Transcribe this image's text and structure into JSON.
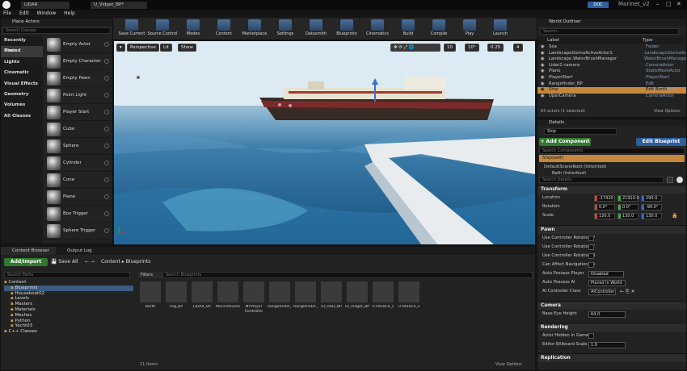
{
  "titlebar": {
    "tabs": [
      "LIDAR",
      "U_Vidget_BP*"
    ],
    "badge": "DOC",
    "project": "Marinet_v2"
  },
  "menubar": [
    "File",
    "Edit",
    "Window",
    "Help"
  ],
  "toolbar": [
    "Save Current",
    "Source Control",
    "Modes",
    "Content",
    "Marketplace",
    "Settings",
    "Datasmith",
    "Blueprints",
    "Cinematics",
    "Build",
    "Compile",
    "Play",
    "Launch"
  ],
  "place_actors": {
    "title": "Place Actors",
    "search_placeholder": "Search Classes",
    "categories": [
      "Recently Placed",
      "Basic",
      "Lights",
      "Cinematic",
      "Visual Effects",
      "Geometry",
      "Volumes",
      "All Classes"
    ],
    "selected_category": "Basic",
    "actors": [
      "Empty Actor",
      "Empty Character",
      "Empty Pawn",
      "Point Light",
      "Player Start",
      "Cube",
      "Sphere",
      "Cylinder",
      "Cone",
      "Plane",
      "Box Trigger",
      "Sphere Trigger"
    ]
  },
  "viewport": {
    "buttons": [
      "Perspective",
      "Lit",
      "Show"
    ],
    "grid": "10",
    "angle": "10°",
    "scale": "0.25",
    "cam": "4"
  },
  "outliner": {
    "title": "World Outliner",
    "search_placeholder": "Search...",
    "col_label": "Label",
    "col_type": "Type",
    "rows": [
      {
        "label": "Sea",
        "type": "Folder"
      },
      {
        "label": "LandscapeGizmoActiveActor1",
        "type": "LandscapeGizmoAc"
      },
      {
        "label": "Landscape.WaterBrushManager",
        "type": "WaterBrushManage"
      },
      {
        "label": "Lidar2 camera",
        "type": "CameraActor"
      },
      {
        "label": "Plane",
        "type": "StaticMeshActor"
      },
      {
        "label": "PlayerStart",
        "type": "PlayerStart"
      },
      {
        "label": "Rangefinder_BP",
        "type": "Edit Rangefinder_E"
      },
      {
        "label": "Ship",
        "type": "Edit Berth"
      },
      {
        "label": "UperCamera",
        "type": "CameraActor"
      }
    ],
    "footer": "63 actors (1 selected)",
    "view_options": "View Options"
  },
  "details": {
    "title": "Details",
    "name": "Ship",
    "add_component": "+ Add Component",
    "edit_blueprint": "Edit Blueprint",
    "search_components": "Search Components",
    "self_label": "Ship(self)",
    "root_component": "DefaultSceneRoot (Inherited)",
    "child_component": "Bath (Inherited)",
    "search_details": "Search Details",
    "transform_title": "Transform",
    "location_label": "Location",
    "location": [
      "-17420",
      "21910.0",
      "290.0"
    ],
    "rotation_label": "Rotation",
    "rotation": [
      "0.0°",
      "0.0°",
      "-90.0°"
    ],
    "scale_label": "Scale",
    "scale": [
      "130.0",
      "130.0",
      "130.0"
    ],
    "pawn_title": "Pawn",
    "pawn_rows": [
      "Use Controller Rotation P",
      "Use Controller Rotation Y",
      "Use Controller Rotation R",
      "Can Affect Navigation Ge"
    ],
    "auto_possess_player_label": "Auto Possess Player",
    "auto_possess_player": "Disabled",
    "auto_possess_ai_label": "Auto Possess AI",
    "auto_possess_ai": "Placed in World",
    "ai_controller_label": "AI Controller Class",
    "ai_controller": "AIController",
    "camera_title": "Camera",
    "base_eye_label": "Base Eye Height",
    "base_eye": "64.0",
    "rendering_title": "Rendering",
    "actor_hidden_label": "Actor Hidden In Game",
    "billboard_label": "Editor Billboard Scale",
    "billboard": "1.0",
    "replication_title": "Replication"
  },
  "content_browser": {
    "tabs": [
      "Content Browser",
      "Output Log"
    ],
    "add_import": "Add/Import",
    "save_all": "Save All",
    "path": [
      "Content",
      "Blueprints"
    ],
    "search_paths": "Search Paths",
    "filters": "Filters",
    "search_blueprints": "Search Blueprints",
    "tree": [
      {
        "label": "Content",
        "indent": 0
      },
      {
        "label": "Blueprints",
        "indent": 1
      },
      {
        "label": "Houseboat02",
        "indent": 1
      },
      {
        "label": "Levels",
        "indent": 1
      },
      {
        "label": "Masters",
        "indent": 1
      },
      {
        "label": "Materials",
        "indent": 1
      },
      {
        "label": "Meshes",
        "indent": 1
      },
      {
        "label": "Python",
        "indent": 1
      },
      {
        "label": "Yacht03",
        "indent": 1
      },
      {
        "label": "C++ Classes",
        "indent": 0
      }
    ],
    "assets": [
      "Berth",
      "Fog_BP",
      "LIDAR_BP",
      "MarinetGameMod",
      "MYPlayer Controller",
      "Rangefinder_BP",
      "Rangefinder_BP_2",
      "UI_HUD_BP",
      "UI_Vidget_BP",
      "UTM30LX_1",
      "UTM30LX_2"
    ],
    "item_count": "11 items",
    "view_options": "View Options"
  }
}
